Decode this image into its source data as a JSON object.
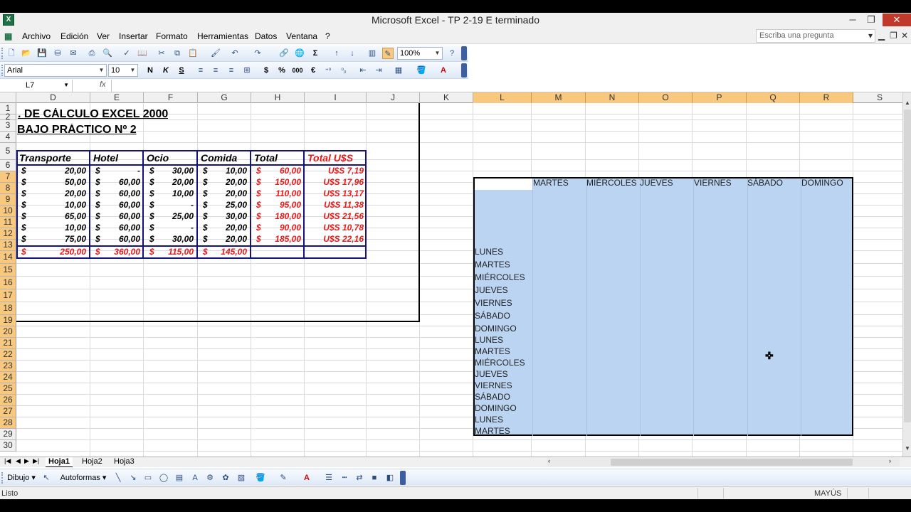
{
  "window": {
    "title": "Microsoft Excel - TP 2-19 E terminado"
  },
  "menu": {
    "items": [
      "Archivo",
      "Edición",
      "Ver",
      "Insertar",
      "Formato",
      "Herramientas",
      "Datos",
      "Ventana",
      "?"
    ],
    "ask_placeholder": "Escriba una pregunta"
  },
  "toolbar": {
    "zoom": "100%",
    "font": "Arial",
    "size": "10",
    "bold": "N",
    "italic": "K",
    "underline": "S",
    "currency": "$",
    "percent": "%",
    "thousands": "000",
    "euro": "€"
  },
  "formula_bar": {
    "cell_ref": "L7",
    "fx": "fx"
  },
  "columns": [
    "D",
    "E",
    "F",
    "G",
    "H",
    "I",
    "J",
    "K",
    "L",
    "M",
    "N",
    "O",
    "P",
    "Q",
    "R",
    "S"
  ],
  "rows": [
    "1",
    "2",
    "3",
    "4",
    "5",
    "6",
    "7",
    "8",
    "9",
    "10",
    "11",
    "12",
    "13",
    "14",
    "15",
    "16",
    "17",
    "18",
    "19",
    "20",
    "21",
    "22",
    "23",
    "24",
    "25",
    "26",
    "27",
    "28",
    "29",
    "30"
  ],
  "sheet": {
    "title1": ". DE CÁLCULO EXCEL 2000",
    "title2": "BAJO PRÁCTICO Nº 2",
    "headers": [
      "Transporte",
      "Hotel",
      "Ocio",
      "Comida",
      "Total",
      "Total U$S"
    ],
    "currency_symbol": "$",
    "table": [
      [
        "20,00",
        "-",
        "30,00",
        "10,00",
        "60,00",
        "U$S 7,19"
      ],
      [
        "50,00",
        "60,00",
        "20,00",
        "20,00",
        "150,00",
        "U$S 17,96"
      ],
      [
        "20,00",
        "60,00",
        "10,00",
        "20,00",
        "110,00",
        "U$S 13,17"
      ],
      [
        "10,00",
        "60,00",
        "-",
        "25,00",
        "95,00",
        "U$S 11,38"
      ],
      [
        "65,00",
        "60,00",
        "25,00",
        "30,00",
        "180,00",
        "U$S 21,56"
      ],
      [
        "10,00",
        "60,00",
        "-",
        "20,00",
        "90,00",
        "U$S 10,78"
      ],
      [
        "75,00",
        "60,00",
        "30,00",
        "20,00",
        "185,00",
        "U$S 22,16"
      ]
    ],
    "totals": [
      "250,00",
      "360,00",
      "115,00",
      "145,00"
    ]
  },
  "weekdays_header": [
    "MARTES",
    "MIÉRCOLES",
    "JUEVES",
    "VIERNES",
    "SÁBADO",
    "DOMINGO"
  ],
  "weekdays_col": [
    "LUNES",
    "MARTES",
    "MIÉRCOLES",
    "JUEVES",
    "VIERNES",
    "SÁBADO",
    "DOMINGO",
    "LUNES",
    "MARTES",
    "MIÉRCOLES",
    "JUEVES",
    "VIERNES",
    "SÁBADO",
    "DOMINGO",
    "LUNES",
    "MARTES"
  ],
  "tabs": [
    "Hoja1",
    "Hoja2",
    "Hoja3"
  ],
  "drawing": {
    "draw": "Dibujo",
    "autoshapes": "Autoformas"
  },
  "status": {
    "text": "Listo",
    "caps": "MAYÚS"
  }
}
